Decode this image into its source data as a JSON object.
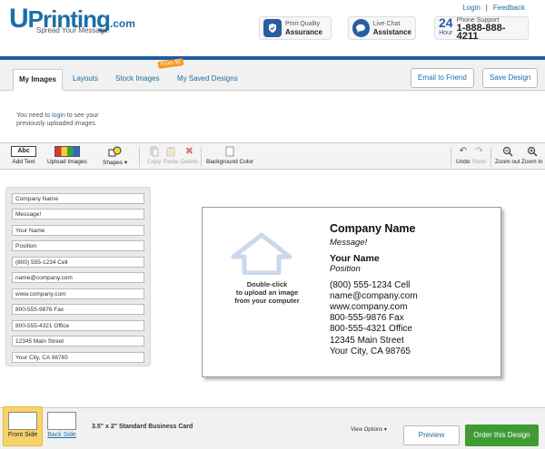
{
  "header": {
    "logo_u": "U",
    "logo_main": "Printing",
    "logo_dotcom": ".com",
    "tagline": "Spread Your Message!",
    "links": {
      "login": "Login",
      "feedback": "Feedback"
    },
    "badges": [
      {
        "small": "Print Quality",
        "big": "Assurance",
        "icon": "shield-icon"
      },
      {
        "small": "Live Chat",
        "big": "Assistance",
        "icon": "chat-bubble-icon"
      }
    ],
    "phone": {
      "hours_num": "24",
      "hours_unit": "Hour",
      "label": "Phone Support",
      "number": "1-888-888-4211"
    }
  },
  "tabs": [
    {
      "label": "My Images",
      "active": true
    },
    {
      "label": "Layouts",
      "active": false
    },
    {
      "label": "Stock Images",
      "active": false
    },
    {
      "label": "My Saved Designs",
      "active": false
    }
  ],
  "stock_tag": "From $1",
  "top_buttons": {
    "email": "Email to Friend",
    "save": "Save Design"
  },
  "message": {
    "pre": "You need to ",
    "link": "login",
    "post": " to see your previously uploaded images."
  },
  "toolbar": {
    "add_text": "Add Text",
    "abc": "Abc",
    "upload_images": "Upload Images",
    "shapes": "Shapes ▾",
    "copy": "Copy",
    "paste": "Paste",
    "delete": "Delete",
    "background_color": "Background Color",
    "undo": "Undo",
    "redo": "Redo",
    "zoom_out": "Zoom out",
    "zoom_in": "Zoom in"
  },
  "fields": [
    "Company Name",
    "Message!",
    "Your Name",
    "Position",
    "(800) 555-1234 Cell",
    "name@company.com",
    "www.company.com",
    "800-555-9876 Fax",
    "800-555-4321 Office",
    "12345 Main Street",
    "Your City, CA 98765"
  ],
  "card": {
    "upload_line1": "Double-click",
    "upload_line2": "to upload an image",
    "upload_line3": "from your computer",
    "company": "Company Name",
    "message": "Message!",
    "name": "Your Name",
    "position": "Position",
    "cell": "(800) 555-1234 Cell",
    "email": "name@company.com",
    "web": "www.company.com",
    "fax": "800-555-9876 Fax",
    "office": "800-555-4321 Office",
    "street": "12345 Main Street",
    "city": "Your City, CA 98765"
  },
  "bottom": {
    "front": "Front Side",
    "back": "Back Side",
    "size": "3.5\" x 2\" Standard Business Card",
    "view_options": "View Options ▾",
    "preview": "Preview",
    "order": "Order this Design"
  },
  "colors": {
    "brand_blue": "#1a6fa8",
    "order_green": "#3f9c35",
    "front_highlight": "#f7d36a"
  }
}
